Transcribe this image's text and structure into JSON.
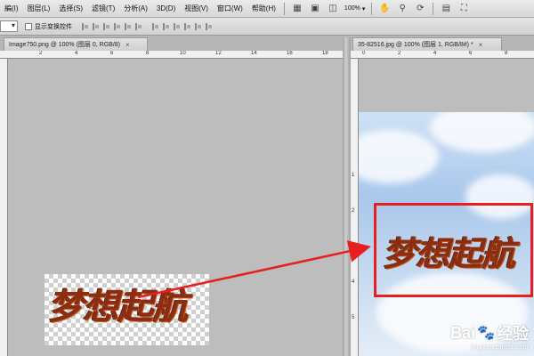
{
  "menubar": {
    "items": [
      "編(I)",
      "图层(L)",
      "选择(S)",
      "滤镜(T)",
      "分析(A)",
      "3D(D)",
      "视图(V)",
      "窗口(W)",
      "帮助(H)"
    ],
    "zoom_value": "100%"
  },
  "options_bar": {
    "show_transform_label": "显示变换控件"
  },
  "tabs": {
    "left": "Image750.png @ 100% (图层 0, RGB/8)",
    "right": "35-82516.jpg @ 100% (图层 1, RGB/8#) *",
    "close_glyph": "×"
  },
  "rulers": {
    "left_h": [
      "2",
      "4",
      "6",
      "8",
      "10",
      "12",
      "14",
      "16",
      "18"
    ],
    "right_h": [
      "0",
      "2",
      "4",
      "6",
      "8"
    ],
    "right_v": [
      "1",
      "2",
      "3",
      "4",
      "5"
    ]
  },
  "artwork": {
    "calligraphy_text": "梦想起航"
  },
  "watermark": {
    "brand": "Bai",
    "brand_suffix": "经验",
    "url": "jingyan.baidu.com"
  },
  "colors": {
    "accent_red": "#e81f1f",
    "menubar_bg": "#dedede",
    "workspace_bg": "#bdbdbd"
  }
}
